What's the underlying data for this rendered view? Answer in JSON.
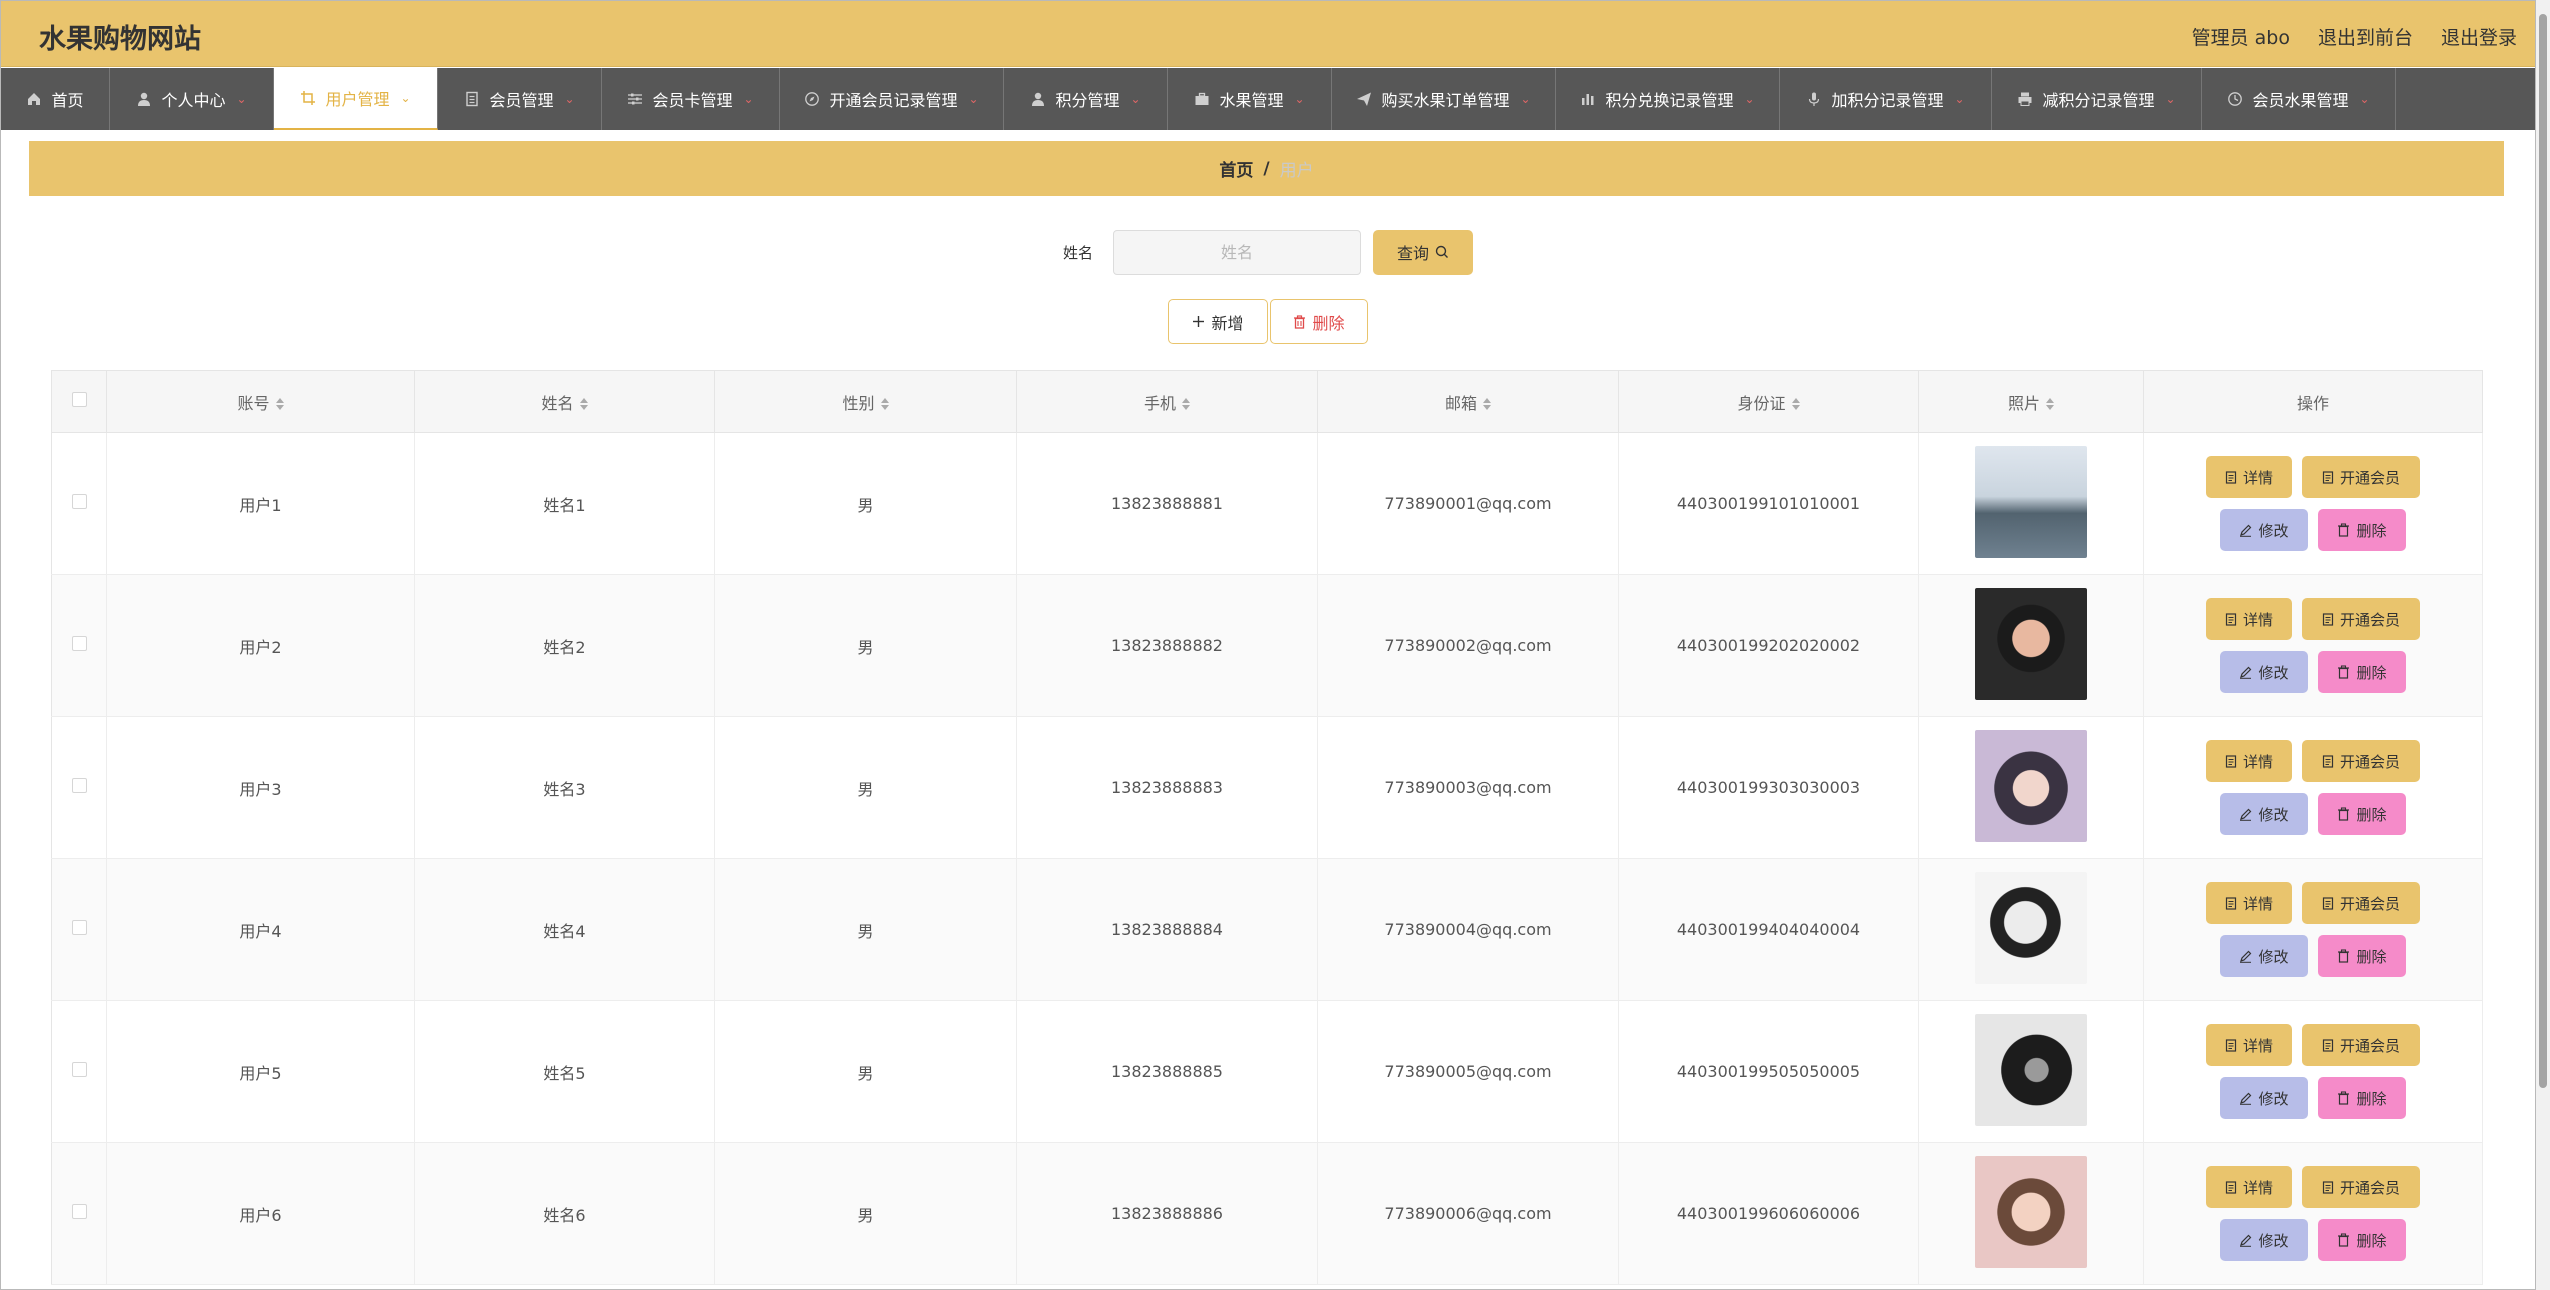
{
  "header": {
    "site_title": "水果购物网站",
    "admin_label": "管理员 abo",
    "back_to_front": "退出到前台",
    "logout": "退出登录"
  },
  "nav": {
    "items": [
      {
        "label": "首页",
        "icon": "home-icon",
        "has_dropdown": false,
        "active": false
      },
      {
        "label": "个人中心",
        "icon": "user-icon",
        "has_dropdown": true,
        "active": false
      },
      {
        "label": "用户管理",
        "icon": "crop-icon",
        "has_dropdown": true,
        "active": true
      },
      {
        "label": "会员管理",
        "icon": "document-icon",
        "has_dropdown": true,
        "active": false
      },
      {
        "label": "会员卡管理",
        "icon": "sliders-icon",
        "has_dropdown": true,
        "active": false
      },
      {
        "label": "开通会员记录管理",
        "icon": "compass-icon",
        "has_dropdown": true,
        "active": false
      },
      {
        "label": "积分管理",
        "icon": "user-icon",
        "has_dropdown": true,
        "active": false
      },
      {
        "label": "水果管理",
        "icon": "briefcase-icon",
        "has_dropdown": true,
        "active": false
      },
      {
        "label": "购买水果订单管理",
        "icon": "send-icon",
        "has_dropdown": true,
        "active": false
      },
      {
        "label": "积分兑换记录管理",
        "icon": "bar-chart-icon",
        "has_dropdown": true,
        "active": false
      },
      {
        "label": "加积分记录管理",
        "icon": "microphone-icon",
        "has_dropdown": true,
        "active": false
      },
      {
        "label": "减积分记录管理",
        "icon": "printer-icon",
        "has_dropdown": true,
        "active": false
      },
      {
        "label": "会员水果管理",
        "icon": "clock-icon",
        "has_dropdown": true,
        "active": false
      }
    ]
  },
  "breadcrumb": {
    "home": "首页",
    "separator": "/",
    "current": "用户"
  },
  "search": {
    "label": "姓名",
    "placeholder": "姓名",
    "query_button": "查询"
  },
  "actions": {
    "add": "新增",
    "delete": "删除"
  },
  "table": {
    "columns": [
      "账号",
      "姓名",
      "性别",
      "手机",
      "邮箱",
      "身份证",
      "照片",
      "操作"
    ],
    "rows": [
      {
        "account": "用户1",
        "name": "姓名1",
        "gender": "男",
        "phone": "13823888881",
        "email": "773890001@qq.com",
        "id_card": "440300199101010001",
        "photo": "photo-1"
      },
      {
        "account": "用户2",
        "name": "姓名2",
        "gender": "男",
        "phone": "13823888882",
        "email": "773890002@qq.com",
        "id_card": "440300199202020002",
        "photo": "photo-2"
      },
      {
        "account": "用户3",
        "name": "姓名3",
        "gender": "男",
        "phone": "13823888883",
        "email": "773890003@qq.com",
        "id_card": "440300199303030003",
        "photo": "photo-3"
      },
      {
        "account": "用户4",
        "name": "姓名4",
        "gender": "男",
        "phone": "13823888884",
        "email": "773890004@qq.com",
        "id_card": "440300199404040004",
        "photo": "photo-4"
      },
      {
        "account": "用户5",
        "name": "姓名5",
        "gender": "男",
        "phone": "13823888885",
        "email": "773890005@qq.com",
        "id_card": "440300199505050005",
        "photo": "photo-5"
      },
      {
        "account": "用户6",
        "name": "姓名6",
        "gender": "男",
        "phone": "13823888886",
        "email": "773890006@qq.com",
        "id_card": "440300199606060006",
        "photo": "photo-6"
      }
    ],
    "row_actions": {
      "detail": "详情",
      "open_member": "开通会员",
      "edit": "修改",
      "delete": "删除"
    }
  },
  "colors": {
    "accent": "#e9c46d",
    "nav_bg": "#575757",
    "edit_btn": "#b7bde8",
    "delete_btn": "#f58bc9",
    "danger_text": "#e04a4a"
  }
}
